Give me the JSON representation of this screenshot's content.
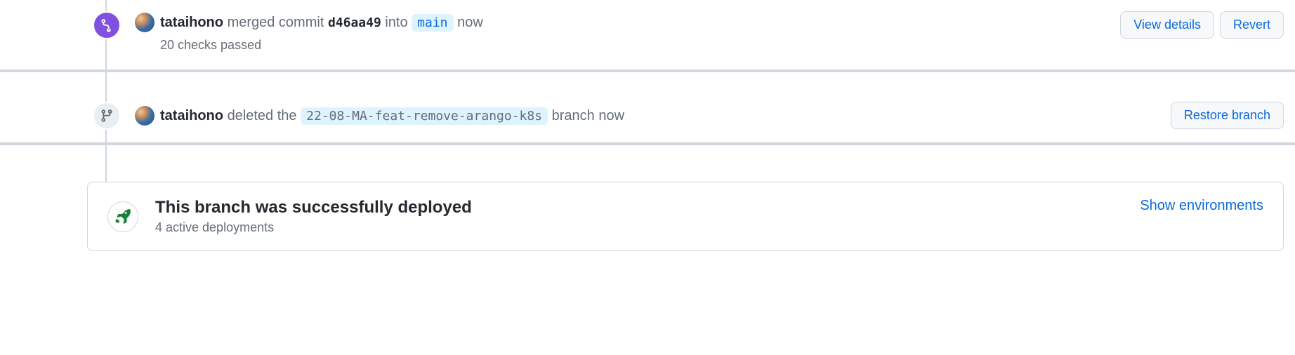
{
  "merge_event": {
    "user": "tataihono",
    "action1": "merged commit",
    "commit_sha": "d46aa49",
    "action2": "into",
    "target_branch": "main",
    "timestamp": "now",
    "checks": "20 checks passed",
    "buttons": {
      "view_details": "View details",
      "revert": "Revert"
    }
  },
  "delete_event": {
    "user": "tataihono",
    "action1": "deleted the",
    "branch_name": "22-08-MA-feat-remove-arango-k8s",
    "action2": "branch now",
    "buttons": {
      "restore": "Restore branch"
    }
  },
  "deploy": {
    "title": "This branch was successfully deployed",
    "subtitle": "4 active deployments",
    "link": "Show environments"
  }
}
